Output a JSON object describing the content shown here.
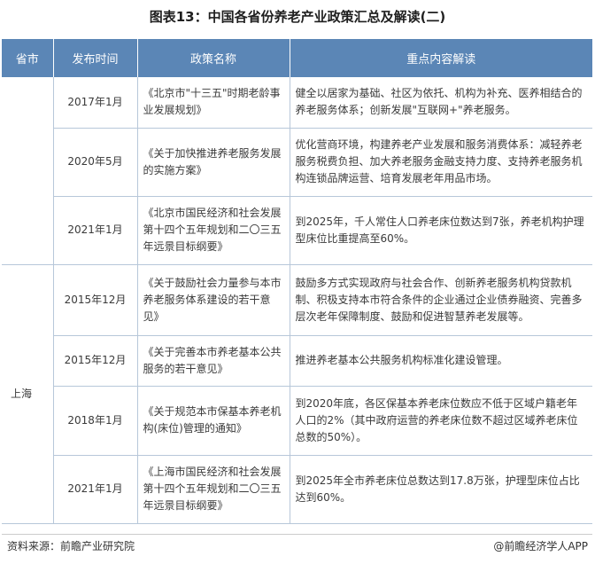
{
  "title": "图表13：中国各省份养老产业政策汇总及解读(二)",
  "headers": [
    "省市",
    "发布时间",
    "政策名称",
    "重点内容解读"
  ],
  "groups": [
    {
      "province": "",
      "rows": [
        {
          "date": "2017年1月",
          "policy": "《北京市\"十三五\"时期老龄事业发展规划》",
          "content": "健全以居家为基础、社区为依托、机构为补充、医养相结合的养老服务体系；创新发展\"互联网+\"养老服务。"
        },
        {
          "date": "2020年5月",
          "policy": "《关于加快推进养老服务发展的实施方案》",
          "content": "优化营商环境，构建养老产业发展和服务消费体系：减轻养老服务税费负担、加大养老服务金融支持力度、支持养老服务机构连锁品牌运营、培育发展老年用品市场。"
        },
        {
          "date": "2021年1月",
          "policy": "《北京市国民经济和社会发展第十四个五年规划和二〇三五年远景目标纲要》",
          "content": "到2025年，千人常住人口养老床位数达到7张，养老机构护理型床位比重提高至60%。"
        }
      ]
    },
    {
      "province": "上海",
      "rows": [
        {
          "date": "2015年12月",
          "policy": "《关于鼓励社会力量参与本市养老服务体系建设的若干意见》",
          "content": "鼓励多方式实现政府与社会合作、创新养老服务机构贷款机制、积极支持本市符合条件的企业通过企业债券融资、完善多层次老年保障制度、鼓励和促进智慧养老发展等。"
        },
        {
          "date": "2015年12月",
          "policy": "《关于完善本市养老基本公共服务的若干意见》",
          "content": "推进养老基本公共服务机构标准化建设管理。"
        },
        {
          "date": "2018年1月",
          "policy": "《关于规范本市保基本养老机构(床位)管理的通知》",
          "content": "到2020年底，各区保基本养老床位数应不低于区域户籍老年人口的2%（其中政府运营的养老床位数不超过区域养老床位总数的50%）。"
        },
        {
          "date": "2021年1月",
          "policy": "《上海市国民经济和社会发展第十四个五年规划和二〇三五年远景目标纲要》",
          "content": "到2025年全市养老床位总数达到17.8万张，护理型床位占比达到60%。"
        }
      ]
    }
  ],
  "footer": {
    "source": "资料来源：前瞻产业研究院",
    "brand": "@前瞻经济学人APP"
  }
}
